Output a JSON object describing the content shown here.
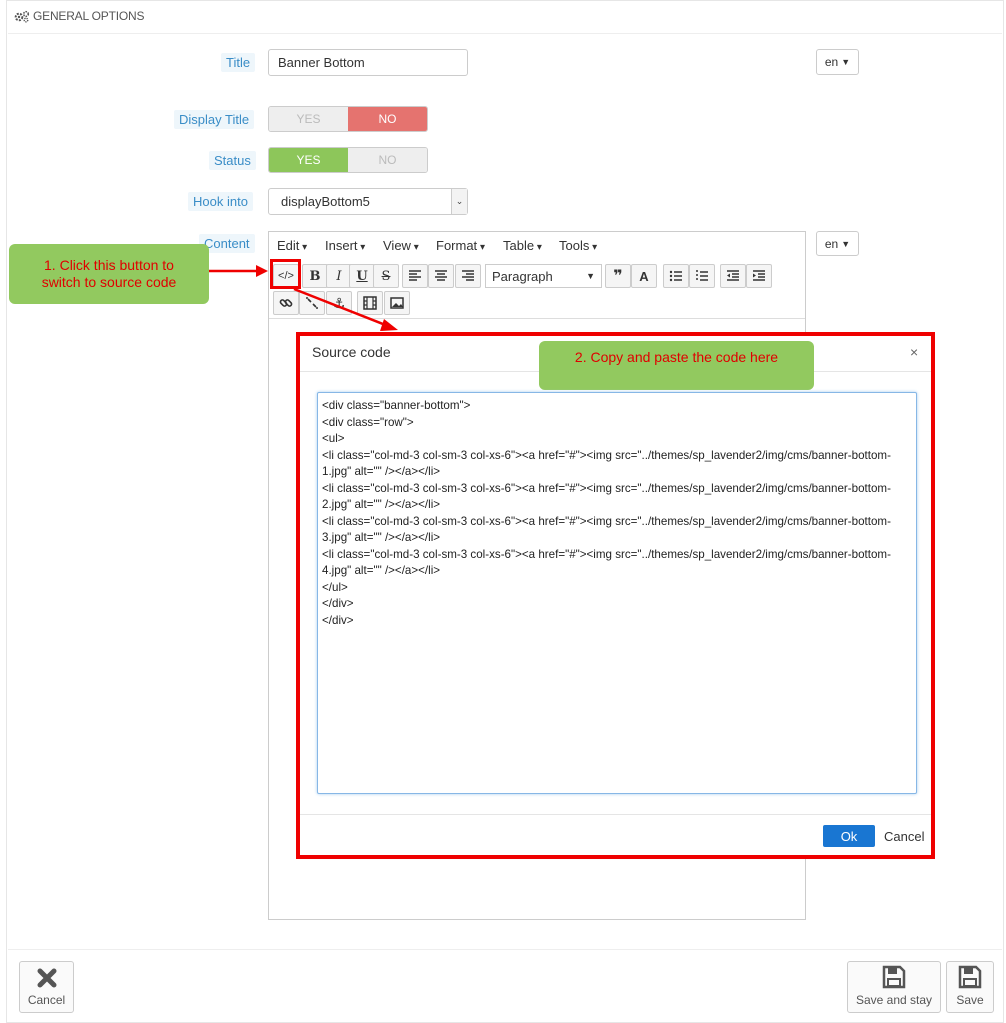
{
  "header": {
    "title": "GENERAL OPTIONS",
    "icon": "gears-icon"
  },
  "form": {
    "title_label": "Title",
    "title_value": "Banner Bottom",
    "title_lang": "en",
    "display_title_label": "Display Title",
    "display_title_yes": "YES",
    "display_title_no": "NO",
    "display_title_selected": "NO",
    "status_label": "Status",
    "status_yes": "YES",
    "status_no": "NO",
    "status_selected": "YES",
    "hook_label": "Hook into",
    "hook_value": "displayBottom5",
    "content_label": "Content",
    "content_lang": "en"
  },
  "editor": {
    "menus": [
      "Edit",
      "Insert",
      "View",
      "Format",
      "Table",
      "Tools"
    ],
    "paragraph_select": "Paragraph"
  },
  "callouts": {
    "step1_line1": "1. Click this button to",
    "step1_line2": "switch to source code",
    "step2": "2. Copy and paste the code here"
  },
  "modal": {
    "title": "Source code",
    "close": "×",
    "code": "<div class=\"banner-bottom\">\n<div class=\"row\">\n<ul>\n<li class=\"col-md-3 col-sm-3 col-xs-6\"><a href=\"#\"><img src=\"../themes/sp_lavender2/img/cms/banner-bottom-1.jpg\" alt=\"\" /></a></li>\n<li class=\"col-md-3 col-sm-3 col-xs-6\"><a href=\"#\"><img src=\"../themes/sp_lavender2/img/cms/banner-bottom-2.jpg\" alt=\"\" /></a></li>\n<li class=\"col-md-3 col-sm-3 col-xs-6\"><a href=\"#\"><img src=\"../themes/sp_lavender2/img/cms/banner-bottom-3.jpg\" alt=\"\" /></a></li>\n<li class=\"col-md-3 col-sm-3 col-xs-6\"><a href=\"#\"><img src=\"../themes/sp_lavender2/img/cms/banner-bottom-4.jpg\" alt=\"\" /></a></li>\n</ul>\n</div>\n</div>",
    "ok": "Ok",
    "cancel": "Cancel"
  },
  "footer": {
    "cancel": "Cancel",
    "save_and_stay": "Save and stay",
    "save": "Save"
  },
  "colors": {
    "label_blue": "#3a8dc7",
    "no_red": "#e5736f",
    "yes_green": "#8dc65a",
    "callout_green": "#92c95f",
    "annotation_red": "#ef0000",
    "ok_blue": "#1976d2"
  }
}
